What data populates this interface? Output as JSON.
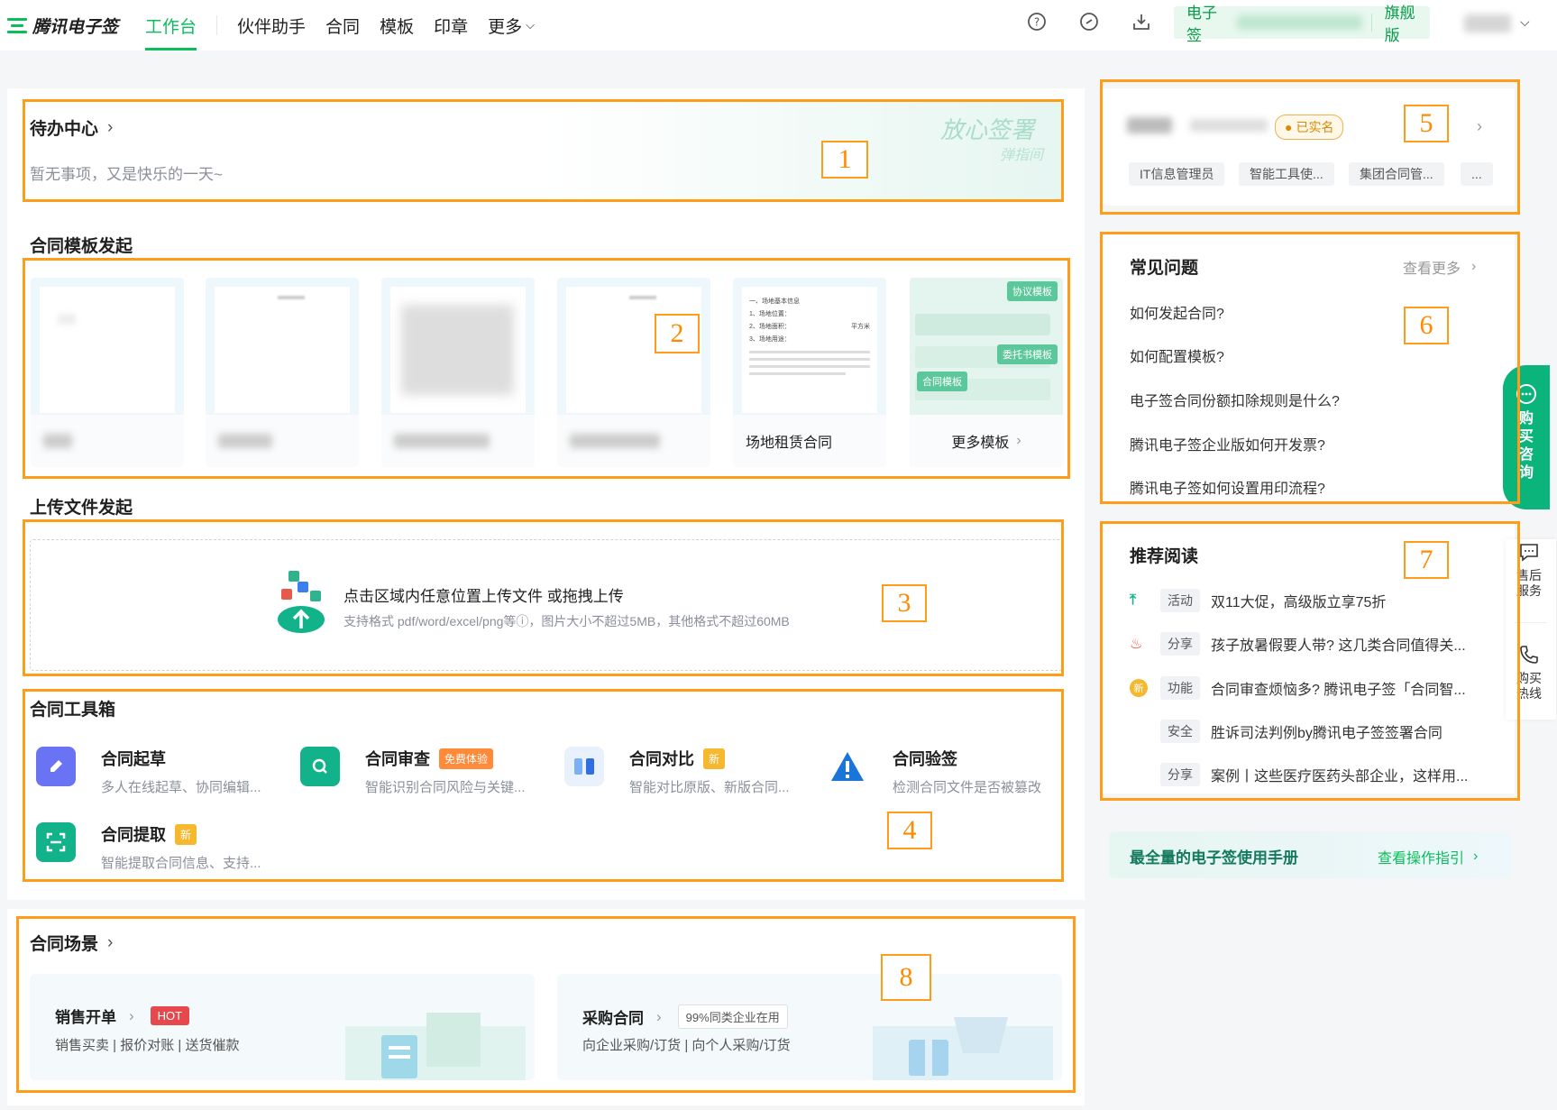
{
  "nav": {
    "logo": "腾讯电子签",
    "items": [
      "工作台",
      "伙伴助手",
      "合同",
      "模板",
      "印章",
      "更多"
    ],
    "plan_prefix": "电子签",
    "plan_name": "旗舰版"
  },
  "todo": {
    "title": "待办中心",
    "empty": "暂无事项，又是快乐的一天~",
    "watermark_1": "放心签署",
    "watermark_2": "弹指间"
  },
  "templates": {
    "title": "合同模板发起",
    "visible_name": "场地租赁合同",
    "more": "更多模板",
    "tag_a": "协议模板",
    "tag_b": "委托书模板",
    "tag_c": "合同模板",
    "doc_lines": [
      "一、场地基本信息",
      "1、场地位置：",
      "2、场地面积：",
      "平方米",
      "3、场地用途："
    ]
  },
  "upload": {
    "title": "上传文件发起",
    "main": "点击区域内任意位置上传文件 或拖拽上传",
    "hint": "支持格式 pdf/word/excel/png等ⓘ，图片大小不超过5MB，其他格式不超过60MB"
  },
  "tools": {
    "title": "合同工具箱",
    "items": [
      {
        "name": "合同起草",
        "desc": "多人在线起草、协同编辑...",
        "tag": ""
      },
      {
        "name": "合同审查",
        "desc": "智能识别合同风险与关键...",
        "tag": "免费体验"
      },
      {
        "name": "合同对比",
        "desc": "智能对比原版、新版合同...",
        "tag": "新"
      },
      {
        "name": "合同验签",
        "desc": "检测合同文件是否被篡改",
        "tag": ""
      },
      {
        "name": "合同提取",
        "desc": "智能提取合同信息、支持...",
        "tag": "新"
      }
    ]
  },
  "scenes": {
    "title": "合同场景",
    "sales": {
      "name": "销售开单",
      "tag": "HOT",
      "desc": "销售买卖 | 报价对账 | 送货催款"
    },
    "purchase": {
      "name": "采购合同",
      "tag": "99%同类企业在用",
      "desc": "向企业采购/订货 | 向个人采购/订货"
    }
  },
  "account": {
    "verified": "已实名",
    "roles": [
      "IT信息管理员",
      "智能工具使...",
      "集团合同管...",
      "..."
    ]
  },
  "faq": {
    "title": "常见问题",
    "more": "查看更多",
    "items": [
      "如何发起合同?",
      "如何配置模板?",
      "电子签合同份额扣除规则是什么?",
      "腾讯电子签企业版如何开发票?",
      "腾讯电子签如何设置用印流程?"
    ]
  },
  "reading": {
    "title": "推荐阅读",
    "items": [
      {
        "icon": "arrow-up-icon",
        "tag": "活动",
        "text": "双11大促，高级版立享75折"
      },
      {
        "icon": "fire-icon",
        "tag": "分享",
        "text": "孩子放暑假要人带? 这几类合同值得关..."
      },
      {
        "icon": "new-icon",
        "tag": "功能",
        "text": "合同审查烦恼多? 腾讯电子签「合同智..."
      },
      {
        "icon": "",
        "tag": "安全",
        "text": "胜诉司法判例by腾讯电子签签署合同"
      },
      {
        "icon": "",
        "tag": "分享",
        "text": "案例丨这些医疗医药头部企业，这样用..."
      }
    ]
  },
  "manual": {
    "title": "最全量的电子签使用手册",
    "link": "查看操作指引"
  },
  "float": {
    "consult": [
      "购",
      "买",
      "咨",
      "询"
    ],
    "after_sales": [
      "售后",
      "服务"
    ],
    "hotline": [
      "购买",
      "热线"
    ]
  },
  "annotations": [
    "1",
    "2",
    "3",
    "4",
    "5",
    "6",
    "7",
    "8"
  ],
  "colors": {
    "accent": "#0abf5b",
    "highlight": "#ff9c1a",
    "hot": "#e5484d",
    "new": "#f5b82e"
  }
}
